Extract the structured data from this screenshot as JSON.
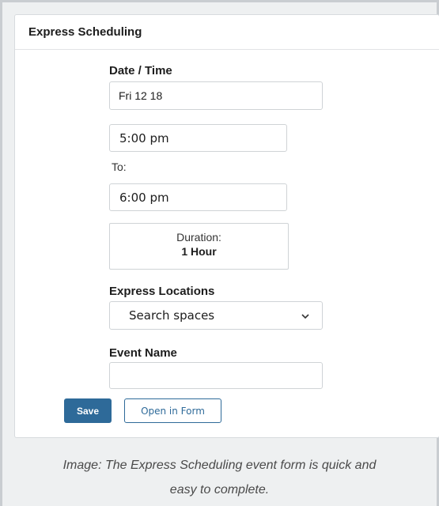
{
  "panel": {
    "title": "Express Scheduling"
  },
  "date_time": {
    "label": "Date / Time",
    "date_value": "Fri 12 18"
  },
  "start_time": {
    "value": "5:00 pm"
  },
  "to_label": "To:",
  "end_time": {
    "value": "6:00 pm"
  },
  "duration": {
    "label": "Duration:",
    "value": "1 Hour"
  },
  "locations": {
    "label": "Express Locations",
    "selected": "Search spaces",
    "icon": "chevron-down-icon"
  },
  "event_name": {
    "label": "Event Name",
    "value": ""
  },
  "buttons": {
    "save": "Save",
    "open_in_form": "Open in Form"
  },
  "caption": {
    "line1": "Image: The Express Scheduling event form is quick and",
    "line2": "easy to complete."
  },
  "colors": {
    "primary": "#2e6a99",
    "border": "#cfd3d6",
    "background": "#eef0f1"
  }
}
